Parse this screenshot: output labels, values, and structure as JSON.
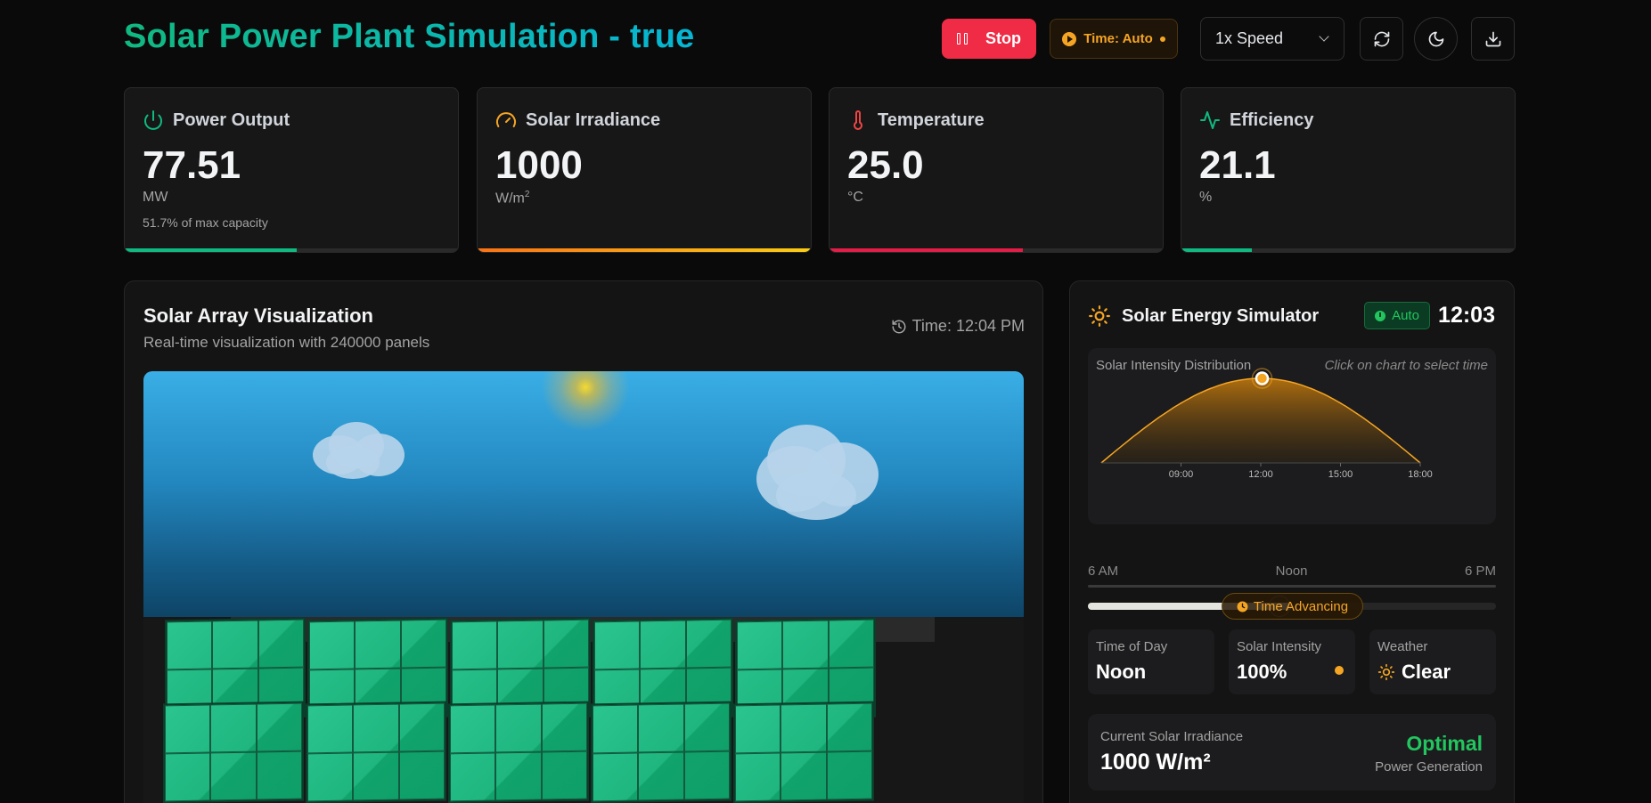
{
  "header": {
    "title": "Solar Power Plant Simulation - true",
    "stop_label": "Stop",
    "time_mode_label": "Time: Auto",
    "speed_value": "1x Speed",
    "icons": [
      "pause-icon",
      "play-icon",
      "chevron-down-icon",
      "refresh-icon",
      "moon-icon",
      "download-icon"
    ]
  },
  "stats": [
    {
      "label": "Power Output",
      "value": "77.51",
      "unit": "MW",
      "sub": "51.7% of max capacity",
      "icon": "power-icon",
      "progress": 0.517,
      "color": "#10b981"
    },
    {
      "label": "Solar Irradiance",
      "value": "1000",
      "unit": "W/m",
      "unit_sup": "2",
      "sub": "",
      "icon": "gauge-icon",
      "progress": 1.0,
      "color": "#f59e0b"
    },
    {
      "label": "Temperature",
      "value": "25.0",
      "unit": "°C",
      "sub": "",
      "icon": "thermometer-icon",
      "progress": 0.58,
      "color": "#e11d48"
    },
    {
      "label": "Efficiency",
      "value": "21.1",
      "unit": "%",
      "sub": "",
      "icon": "activity-icon",
      "progress": 0.211,
      "color": "#10b981"
    }
  ],
  "visualization": {
    "title": "Solar Array Visualization",
    "subtitle": "Real-time visualization with 240000 panels",
    "time_label": "Time: 12:04 PM"
  },
  "simulator": {
    "title": "Solar Energy Simulator",
    "auto_badge": "Auto",
    "clock": "12:03",
    "distribution": {
      "title": "Solar Intensity Distribution",
      "hint": "Click on chart to select time",
      "ticks": [
        "09:00",
        "12:00",
        "15:00",
        "18:00"
      ],
      "selected_hour": 12.05
    },
    "range": {
      "start": "6 AM",
      "mid": "Noon",
      "end": "6 PM",
      "progress": 0.5,
      "badge": "Time Advancing"
    },
    "cards": [
      {
        "label": "Time of Day",
        "value": "Noon"
      },
      {
        "label": "Solar Intensity",
        "value": "100%"
      },
      {
        "label": "Weather",
        "value": "Clear"
      }
    ],
    "irradiance": {
      "label": "Current Solar Irradiance",
      "value": "1000 W/m²",
      "status": "Optimal",
      "status_sub": "Power Generation"
    }
  },
  "colors": {
    "accent_green": "#10b981",
    "accent_amber": "#f5a524",
    "stop_red": "#ef2b45"
  }
}
